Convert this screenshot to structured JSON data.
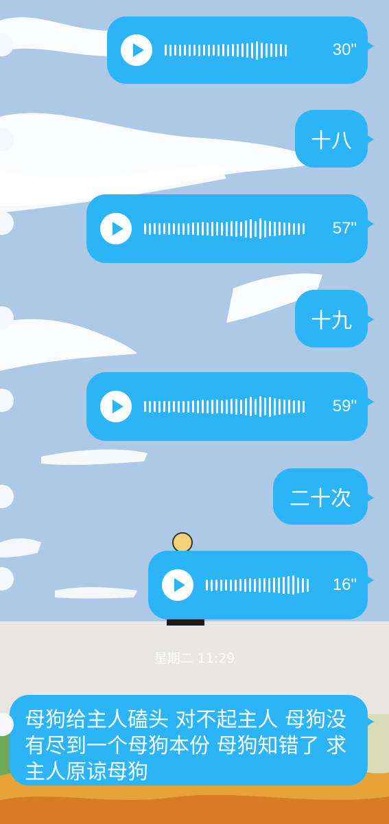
{
  "colors": {
    "bubble": "#2BB5F8",
    "sky": "#AEC9E6",
    "sand": "#E9E7E4",
    "leaves": "#E8A23A"
  },
  "icons": {
    "play": "play-icon"
  },
  "messages": [
    {
      "type": "voice",
      "duration": "30\"",
      "bars": [
        0.35,
        0.4,
        0.35,
        0.4,
        0.35,
        0.4,
        0.38,
        0.4,
        0.35,
        0.4,
        0.38,
        0.42,
        0.45,
        0.4,
        0.45,
        0.5,
        0.55,
        0.6,
        0.7,
        0.85,
        0.7,
        0.6,
        0.55,
        0.5,
        0.45,
        0.4
      ]
    },
    {
      "type": "text",
      "text": "十八"
    },
    {
      "type": "voice",
      "duration": "57\"",
      "bars": [
        0.35,
        0.4,
        0.35,
        0.4,
        0.35,
        0.4,
        0.38,
        0.4,
        0.42,
        0.4,
        0.45,
        0.5,
        0.55,
        0.5,
        0.6,
        0.55,
        0.5,
        0.6,
        0.65,
        0.7,
        0.6,
        0.75,
        0.9,
        0.7,
        1.0,
        0.75,
        0.65,
        0.6,
        0.55,
        0.5,
        0.45,
        0.4,
        0.4,
        0.38
      ]
    },
    {
      "type": "text",
      "text": "十九"
    },
    {
      "type": "voice",
      "duration": "59\"",
      "bars": [
        0.35,
        0.4,
        0.35,
        0.4,
        0.35,
        0.4,
        0.38,
        0.4,
        0.42,
        0.4,
        0.45,
        0.5,
        0.55,
        0.5,
        0.6,
        0.55,
        0.5,
        0.6,
        0.65,
        0.7,
        0.6,
        0.75,
        0.9,
        0.7,
        1.0,
        0.8,
        0.95,
        0.75,
        0.7,
        0.6,
        0.55,
        0.5,
        0.45,
        0.4
      ]
    },
    {
      "type": "text",
      "text": "二十次"
    },
    {
      "type": "voice",
      "duration": "16\"",
      "bars": [
        0.35,
        0.4,
        0.35,
        0.4,
        0.38,
        0.4,
        0.42,
        0.45,
        0.5,
        0.55,
        0.5,
        0.6,
        0.55,
        0.6,
        0.65,
        0.7,
        0.75,
        0.8,
        0.9,
        0.7,
        0.6,
        0.5
      ]
    }
  ],
  "timestamp": "星期二 11:29",
  "last_message": "母狗给主人磕头 对不起主人 母狗没有尽到一个母狗本份 母狗知错了 求主人原谅母狗"
}
